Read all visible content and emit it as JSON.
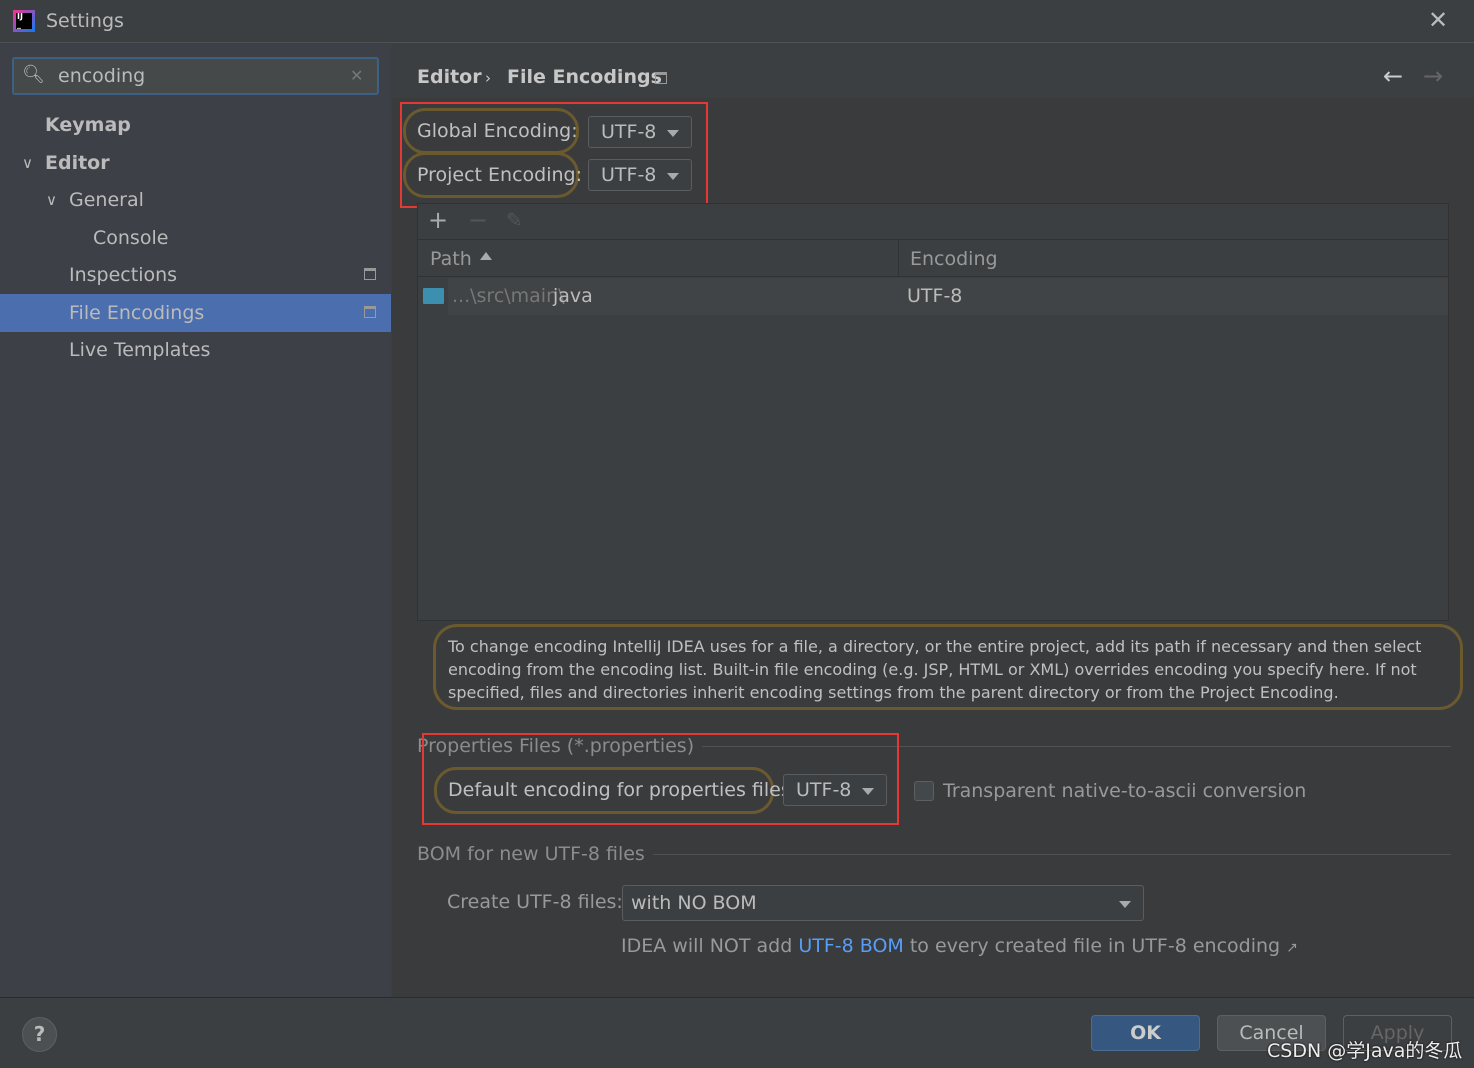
{
  "window": {
    "title": "Settings",
    "close_icon": "close-icon",
    "app_logo": "IJ"
  },
  "search": {
    "value": "encoding"
  },
  "sidebar": {
    "items": [
      {
        "label": "Keymap",
        "level": 0,
        "bold": true
      },
      {
        "label": "Editor",
        "level": 0,
        "bold": true,
        "expanded": true
      },
      {
        "label": "General",
        "level": 1,
        "expanded": true
      },
      {
        "label": "Console",
        "level": 2
      },
      {
        "label": "Inspections",
        "level": 1,
        "project_icon": true
      },
      {
        "label": "File Encodings",
        "level": 1,
        "selected": true,
        "project_icon": true
      },
      {
        "label": "Live Templates",
        "level": 1
      }
    ]
  },
  "breadcrumb": {
    "parent": "Editor",
    "separator": "›",
    "current": "File Encodings"
  },
  "encodings": {
    "global_label": "Global Encoding:",
    "global_value": "UTF-8",
    "project_label": "Project Encoding:",
    "project_value": "UTF-8"
  },
  "table": {
    "columns": [
      "Path",
      "Encoding"
    ],
    "rows": [
      {
        "path_prefix": "...\\src\\main\\",
        "path_last": "java",
        "encoding": "UTF-8"
      }
    ]
  },
  "hint": "To change encoding IntelliJ IDEA uses for a file, a directory, or the entire project, add its path if necessary and then select encoding from the encoding list. Built-in file encoding (e.g. JSP, HTML or XML) overrides encoding you specify here. If not specified, files and directories inherit encoding settings from the parent directory or from the Project Encoding.",
  "properties": {
    "section": "Properties Files (*.properties)",
    "label": "Default encoding for properties files:",
    "value": "UTF-8",
    "checkbox_label": "Transparent native-to-ascii conversion",
    "checked": false
  },
  "bom": {
    "section": "BOM for new UTF-8 files",
    "label": "Create UTF-8 files:",
    "value": "with NO BOM",
    "note_pre": "IDEA will NOT add ",
    "note_link": "UTF-8 BOM",
    "note_post": " to every created file in UTF-8 encoding",
    "link_color": "#589df6"
  },
  "footer": {
    "help": "?",
    "ok": "OK",
    "cancel": "Cancel",
    "apply": "Apply"
  },
  "watermark": "CSDN @学Java的冬瓜",
  "colors": {
    "selection": "#4b6eaf",
    "highlight_red": "#e53935",
    "ok_button": "#365880"
  }
}
